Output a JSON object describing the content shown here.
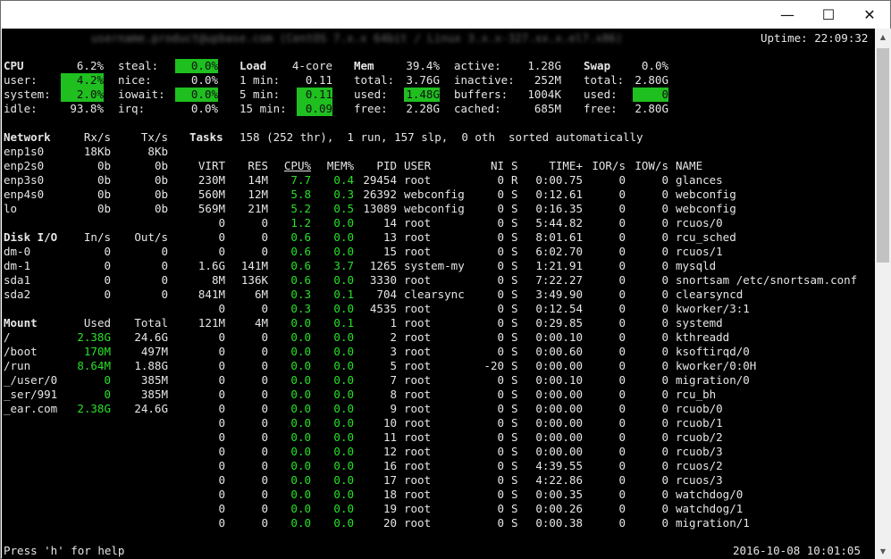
{
  "window": {
    "minimize": "—",
    "maximize": "☐",
    "close": "✕"
  },
  "header": {
    "host": "username.product@upbase.com (CentOS 7.x.x 64bit / Linux 3.x.x-327.xx.x.el7.x86)",
    "uptime": "Uptime: 22:09:32"
  },
  "cpu": {
    "label": "CPU",
    "total": "6.2%",
    "user_l": "user:",
    "user": "4.2%",
    "system_l": "system:",
    "system": "2.0%",
    "idle_l": "idle:",
    "idle": "93.8%",
    "steal_l": "steal:",
    "steal": "0.0%",
    "nice_l": "nice:",
    "nice": "0.0%",
    "iowait_l": "iowait:",
    "iowait": "0.0%",
    "irq_l": "irq:",
    "irq": "0.0%"
  },
  "load": {
    "label": "Load",
    "cores": "4-core",
    "m1_l": "1 min:",
    "m1": "0.11",
    "m5_l": "5 min:",
    "m5": "0.11",
    "m15_l": "15 min:",
    "m15": "0.09"
  },
  "mem": {
    "label": "Mem",
    "pct": "39.4%",
    "total_l": "total:",
    "total": "3.76G",
    "used_l": "used:",
    "used": "1.48G",
    "free_l": "free:",
    "free": "2.28G",
    "active_l": "active:",
    "active": "1.28G",
    "inactive_l": "inactive:",
    "inactive": "252M",
    "buffers_l": "buffers:",
    "buffers": "1004K",
    "cached_l": "cached:",
    "cached": "685M"
  },
  "swap": {
    "label": "Swap",
    "pct": "0.0%",
    "total_l": "total:",
    "total": "2.80G",
    "used_l": "used:",
    "used": "0",
    "free_l": "free:",
    "free": "2.80G"
  },
  "network": {
    "h_name": "Network",
    "h_rx": "Rx/s",
    "h_tx": "Tx/s",
    "rows": [
      {
        "name": "enp1s0",
        "rx": "18Kb",
        "tx": "8Kb"
      },
      {
        "name": "enp2s0",
        "rx": "0b",
        "tx": "0b"
      },
      {
        "name": "enp3s0",
        "rx": "0b",
        "tx": "0b"
      },
      {
        "name": "enp4s0",
        "rx": "0b",
        "tx": "0b"
      },
      {
        "name": "lo",
        "rx": "0b",
        "tx": "0b"
      }
    ]
  },
  "disk": {
    "h_name": "Disk I/O",
    "h_in": "In/s",
    "h_out": "Out/s",
    "rows": [
      {
        "name": "dm-0",
        "in": "0",
        "out": "0"
      },
      {
        "name": "dm-1",
        "in": "0",
        "out": "0"
      },
      {
        "name": "sda1",
        "in": "0",
        "out": "0"
      },
      {
        "name": "sda2",
        "in": "0",
        "out": "0"
      }
    ]
  },
  "mount": {
    "h_name": "Mount",
    "h_used": "Used",
    "h_total": "Total",
    "rows": [
      {
        "name": "/",
        "used": "2.38G",
        "total": "24.6G"
      },
      {
        "name": "/boot",
        "used": "170M",
        "total": "497M"
      },
      {
        "name": "/run",
        "used": "8.64M",
        "total": "1.88G"
      },
      {
        "name": "_/user/0",
        "used": "0",
        "total": "385M"
      },
      {
        "name": "_ser/991",
        "used": "0",
        "total": "385M"
      },
      {
        "name": "_ear.com",
        "used": "2.38G",
        "total": "24.6G"
      }
    ]
  },
  "tasks": {
    "label": "Tasks",
    "summary": "158 (252 thr),  1 run, 157 slp,  0 oth  sorted automatically"
  },
  "proc_headers": {
    "virt": "VIRT",
    "res": "RES",
    "cpu": "CPU%",
    "mem": "MEM%",
    "pid": "PID",
    "user": "USER",
    "ni": "NI",
    "s": "S",
    "time": "TIME+",
    "ior": "IOR/s",
    "iow": "IOW/s",
    "name": "NAME"
  },
  "processes": [
    {
      "virt": "230M",
      "res": "14M",
      "cpu": "7.7",
      "mem": "0.4",
      "pid": "29454",
      "user": "root",
      "ni": "0",
      "s": "R",
      "time": "0:00.75",
      "ior": "0",
      "iow": "0",
      "name": "glances"
    },
    {
      "virt": "560M",
      "res": "12M",
      "cpu": "5.8",
      "mem": "0.3",
      "pid": "26392",
      "user": "webconfig",
      "ni": "0",
      "s": "S",
      "time": "0:12.61",
      "ior": "0",
      "iow": "0",
      "name": "webconfig"
    },
    {
      "virt": "569M",
      "res": "21M",
      "cpu": "5.2",
      "mem": "0.5",
      "pid": "13089",
      "user": "webconfig",
      "ni": "0",
      "s": "S",
      "time": "0:16.35",
      "ior": "0",
      "iow": "0",
      "name": "webconfig"
    },
    {
      "virt": "0",
      "res": "0",
      "cpu": "1.2",
      "mem": "0.0",
      "pid": "14",
      "user": "root",
      "ni": "0",
      "s": "S",
      "time": "5:44.82",
      "ior": "0",
      "iow": "0",
      "name": "rcuos/0"
    },
    {
      "virt": "0",
      "res": "0",
      "cpu": "0.6",
      "mem": "0.0",
      "pid": "13",
      "user": "root",
      "ni": "0",
      "s": "S",
      "time": "8:01.61",
      "ior": "0",
      "iow": "0",
      "name": "rcu_sched"
    },
    {
      "virt": "0",
      "res": "0",
      "cpu": "0.6",
      "mem": "0.0",
      "pid": "15",
      "user": "root",
      "ni": "0",
      "s": "S",
      "time": "6:02.70",
      "ior": "0",
      "iow": "0",
      "name": "rcuos/1"
    },
    {
      "virt": "1.6G",
      "res": "141M",
      "cpu": "0.6",
      "mem": "3.7",
      "pid": "1265",
      "user": "system-my",
      "ni": "0",
      "s": "S",
      "time": "1:21.91",
      "ior": "0",
      "iow": "0",
      "name": "mysqld"
    },
    {
      "virt": "8M",
      "res": "136K",
      "cpu": "0.6",
      "mem": "0.0",
      "pid": "3330",
      "user": "root",
      "ni": "0",
      "s": "S",
      "time": "7:22.27",
      "ior": "0",
      "iow": "0",
      "name": "snortsam /etc/snortsam.conf"
    },
    {
      "virt": "841M",
      "res": "6M",
      "cpu": "0.3",
      "mem": "0.1",
      "pid": "704",
      "user": "clearsync",
      "ni": "0",
      "s": "S",
      "time": "3:49.90",
      "ior": "0",
      "iow": "0",
      "name": "clearsyncd"
    },
    {
      "virt": "0",
      "res": "0",
      "cpu": "0.3",
      "mem": "0.0",
      "pid": "4535",
      "user": "root",
      "ni": "0",
      "s": "S",
      "time": "0:12.54",
      "ior": "0",
      "iow": "0",
      "name": "kworker/3:1"
    },
    {
      "virt": "121M",
      "res": "4M",
      "cpu": "0.0",
      "mem": "0.1",
      "pid": "1",
      "user": "root",
      "ni": "0",
      "s": "S",
      "time": "0:29.85",
      "ior": "0",
      "iow": "0",
      "name": "systemd"
    },
    {
      "virt": "0",
      "res": "0",
      "cpu": "0.0",
      "mem": "0.0",
      "pid": "2",
      "user": "root",
      "ni": "0",
      "s": "S",
      "time": "0:00.10",
      "ior": "0",
      "iow": "0",
      "name": "kthreadd"
    },
    {
      "virt": "0",
      "res": "0",
      "cpu": "0.0",
      "mem": "0.0",
      "pid": "3",
      "user": "root",
      "ni": "0",
      "s": "S",
      "time": "0:00.60",
      "ior": "0",
      "iow": "0",
      "name": "ksoftirqd/0"
    },
    {
      "virt": "0",
      "res": "0",
      "cpu": "0.0",
      "mem": "0.0",
      "pid": "5",
      "user": "root",
      "ni": "-20",
      "s": "S",
      "time": "0:00.00",
      "ior": "0",
      "iow": "0",
      "name": "kworker/0:0H"
    },
    {
      "virt": "0",
      "res": "0",
      "cpu": "0.0",
      "mem": "0.0",
      "pid": "7",
      "user": "root",
      "ni": "0",
      "s": "S",
      "time": "0:00.10",
      "ior": "0",
      "iow": "0",
      "name": "migration/0"
    },
    {
      "virt": "0",
      "res": "0",
      "cpu": "0.0",
      "mem": "0.0",
      "pid": "8",
      "user": "root",
      "ni": "0",
      "s": "S",
      "time": "0:00.00",
      "ior": "0",
      "iow": "0",
      "name": "rcu_bh"
    },
    {
      "virt": "0",
      "res": "0",
      "cpu": "0.0",
      "mem": "0.0",
      "pid": "9",
      "user": "root",
      "ni": "0",
      "s": "S",
      "time": "0:00.00",
      "ior": "0",
      "iow": "0",
      "name": "rcuob/0"
    },
    {
      "virt": "0",
      "res": "0",
      "cpu": "0.0",
      "mem": "0.0",
      "pid": "10",
      "user": "root",
      "ni": "0",
      "s": "S",
      "time": "0:00.00",
      "ior": "0",
      "iow": "0",
      "name": "rcuob/1"
    },
    {
      "virt": "0",
      "res": "0",
      "cpu": "0.0",
      "mem": "0.0",
      "pid": "11",
      "user": "root",
      "ni": "0",
      "s": "S",
      "time": "0:00.00",
      "ior": "0",
      "iow": "0",
      "name": "rcuob/2"
    },
    {
      "virt": "0",
      "res": "0",
      "cpu": "0.0",
      "mem": "0.0",
      "pid": "12",
      "user": "root",
      "ni": "0",
      "s": "S",
      "time": "0:00.00",
      "ior": "0",
      "iow": "0",
      "name": "rcuob/3"
    },
    {
      "virt": "0",
      "res": "0",
      "cpu": "0.0",
      "mem": "0.0",
      "pid": "16",
      "user": "root",
      "ni": "0",
      "s": "S",
      "time": "4:39.55",
      "ior": "0",
      "iow": "0",
      "name": "rcuos/2"
    },
    {
      "virt": "0",
      "res": "0",
      "cpu": "0.0",
      "mem": "0.0",
      "pid": "17",
      "user": "root",
      "ni": "0",
      "s": "S",
      "time": "4:22.86",
      "ior": "0",
      "iow": "0",
      "name": "rcuos/3"
    },
    {
      "virt": "0",
      "res": "0",
      "cpu": "0.0",
      "mem": "0.0",
      "pid": "18",
      "user": "root",
      "ni": "0",
      "s": "S",
      "time": "0:00.35",
      "ior": "0",
      "iow": "0",
      "name": "watchdog/0"
    },
    {
      "virt": "0",
      "res": "0",
      "cpu": "0.0",
      "mem": "0.0",
      "pid": "19",
      "user": "root",
      "ni": "0",
      "s": "S",
      "time": "0:00.26",
      "ior": "0",
      "iow": "0",
      "name": "watchdog/1"
    },
    {
      "virt": "0",
      "res": "0",
      "cpu": "0.0",
      "mem": "0.0",
      "pid": "20",
      "user": "root",
      "ni": "0",
      "s": "S",
      "time": "0:00.38",
      "ior": "0",
      "iow": "0",
      "name": "migration/1"
    }
  ],
  "footer": {
    "help": "Press 'h' for help",
    "datetime": "2016-10-08 10:01:05"
  },
  "colors": {
    "highlight": "#1fbf1f",
    "accent": "#28e028",
    "terminal_bg": "#000000"
  }
}
